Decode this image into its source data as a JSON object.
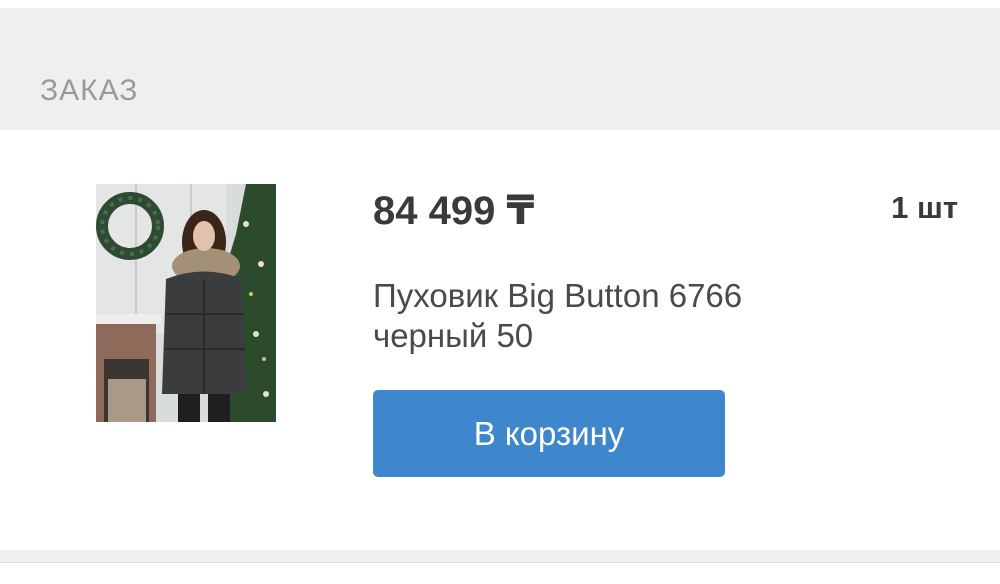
{
  "order_section": {
    "title": "ЗАКАЗ"
  },
  "order_item": {
    "price": "84 499 ₸",
    "quantity": "1 шт",
    "name": "Пуховик Big Button 6766 черный 50",
    "add_to_cart_label": "В корзину",
    "image_alt": "Пуховик Big Button 6766 черный 50"
  },
  "colors": {
    "accent_button": "#3f87cc",
    "header_bg": "#efefef",
    "title_text": "#9a9a9a",
    "body_text": "#3a3a3a"
  }
}
